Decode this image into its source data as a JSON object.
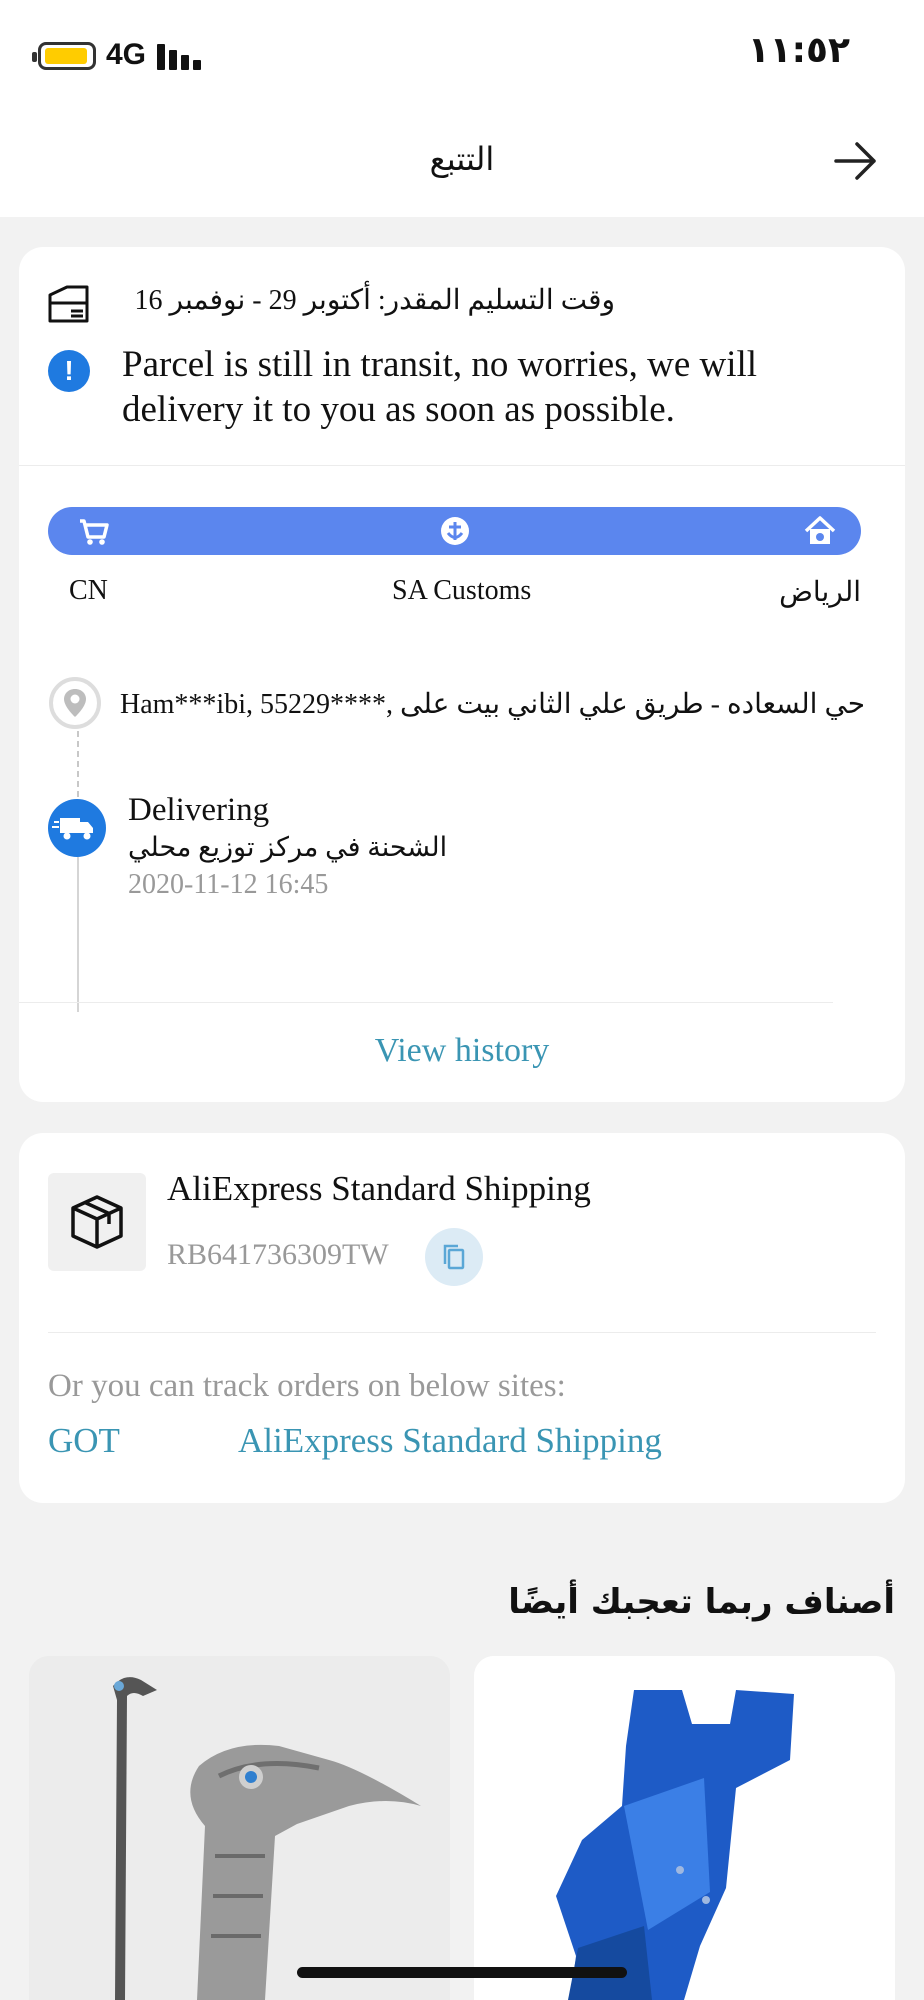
{
  "status_bar": {
    "network": "4G",
    "time": "١١:٥٢"
  },
  "header": {
    "title": "التتبع"
  },
  "tracking": {
    "eta": "وقت التسليم المقدر: أكتوبر 29 - نوفمبر 16",
    "message": "Parcel is still in transit, no worries, we will delivery it to you as soon as possible.",
    "stages": [
      "CN",
      "SA Customs",
      "الرياض"
    ],
    "address": "Ham***ibi,  55229****,  حي السعاده - طريق علي الثاني بيت على",
    "latest_event": {
      "title": "Delivering",
      "subtitle": "الشحنة في مركز توزيع محلي",
      "time": "2020-11-12 16:45"
    },
    "view_history": "View history"
  },
  "shipping": {
    "carrier": "AliExpress Standard Shipping",
    "tracking_number": "RB641736309TW",
    "note": "Or you can track orders on below sites:",
    "sites": [
      "GOT",
      "AliExpress Standard Shipping"
    ]
  },
  "recommendations": {
    "title": "أصناف ربما تعجبك أيضًا"
  },
  "colors": {
    "accent": "#5b86ee",
    "link": "#3a95b3",
    "info": "#1f7ae0"
  }
}
